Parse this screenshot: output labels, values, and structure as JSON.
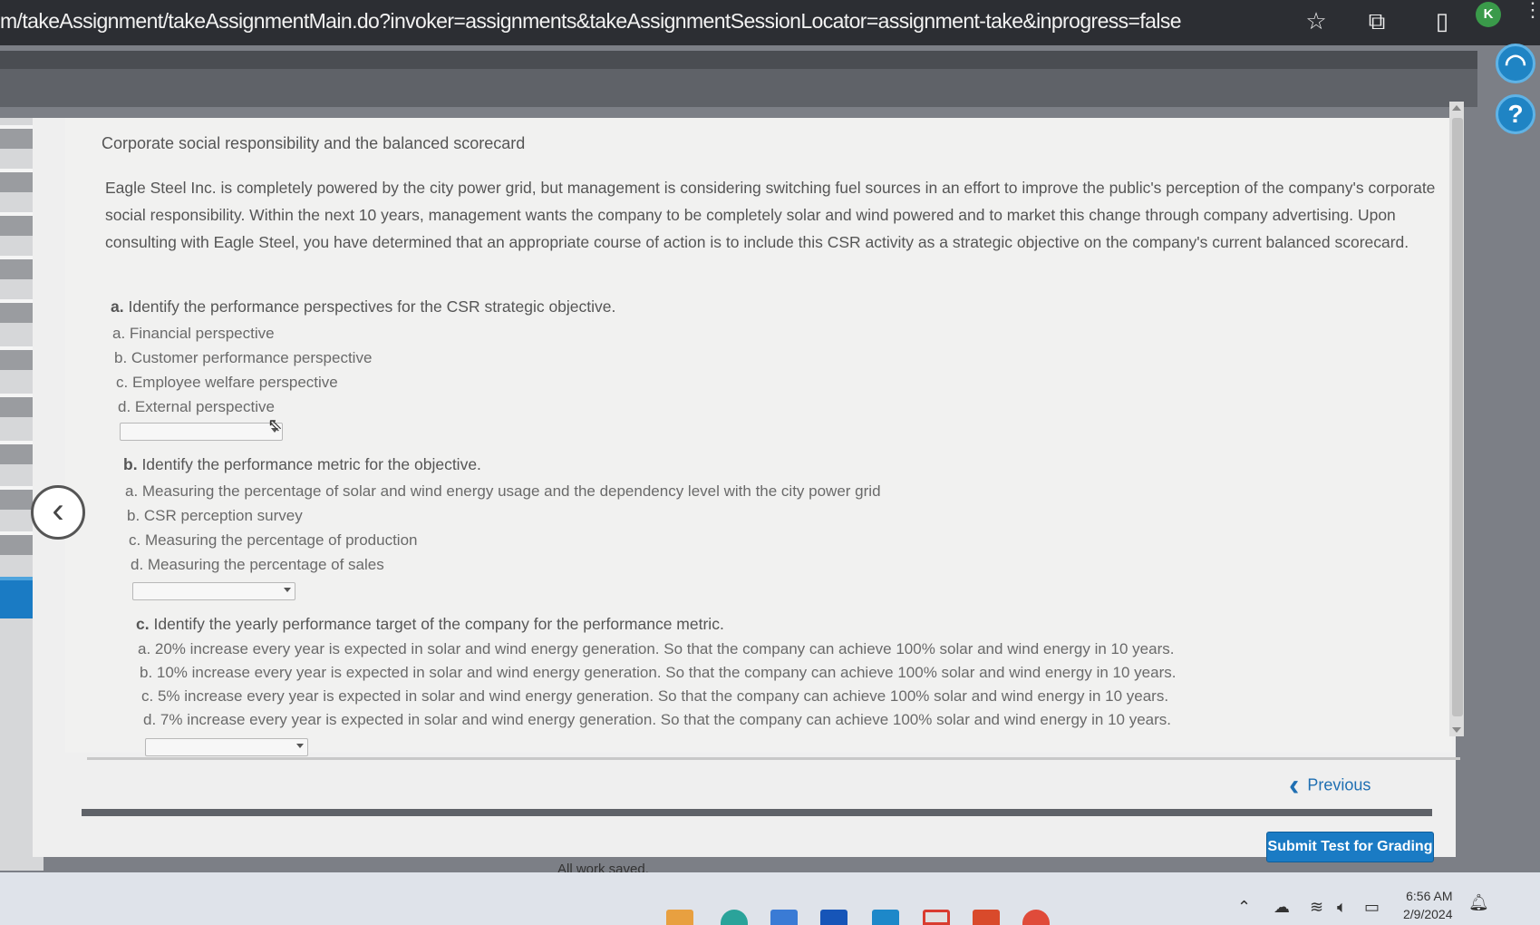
{
  "browser": {
    "url": "m/takeAssignment/takeAssignmentMain.do?invoker=assignments&takeAssignmentSessionLocator=assignment-take&inprogress=false",
    "profile_initial": "K"
  },
  "rail": {
    "help_glyph": "?"
  },
  "question": {
    "title": "Corporate social responsibility and the balanced scorecard",
    "paragraph": "Eagle Steel Inc. is completely powered by the city power grid, but management is considering switching fuel sources in an effort to improve the public's perception of the company's corporate social responsibility. Within the next 10 years, management wants the company to be completely solar and wind powered and to market this change through company advertising. Upon consulting with Eagle Steel, you have determined that an appropriate course of action is to include this CSR activity as a strategic objective on the company's current balanced scorecard.",
    "parts": [
      {
        "letter": "a.",
        "prompt": "Identify the performance perspectives for the CSR strategic objective.",
        "options": [
          "a. Financial perspective",
          "b. Customer performance perspective",
          "c. Employee welfare perspective",
          "d. External perspective"
        ],
        "selected": ""
      },
      {
        "letter": "b.",
        "prompt": "Identify the performance metric for the objective.",
        "options": [
          "a. Measuring the percentage of solar and wind energy usage and the dependency level with the city power grid",
          "b. CSR perception survey",
          "c. Measuring the percentage of production",
          "d. Measuring the percentage of sales"
        ],
        "selected": ""
      },
      {
        "letter": "c.",
        "prompt": "Identify the yearly performance target of the company for the performance metric.",
        "options": [
          "a. 20% increase every year is expected in solar and wind energy generation. So that the company can achieve 100% solar and wind energy in 10 years.",
          "b. 10% increase every year is expected in solar and wind energy generation. So that the company can achieve 100% solar and wind energy in 10 years.",
          "c. 5% increase every year is expected in solar and wind energy generation. So that the company can achieve 100% solar and wind energy in 10 years.",
          "d. 7% increase every year is expected in solar and wind energy generation. So that the company can achieve 100% solar and wind energy in 10 years."
        ],
        "selected": ""
      }
    ]
  },
  "footer": {
    "previous_label": "Previous",
    "submit_label": "Submit Test for Grading",
    "saved_status": "All work saved."
  },
  "taskbar": {
    "time": "6:56 AM",
    "date": "2/9/2024"
  }
}
